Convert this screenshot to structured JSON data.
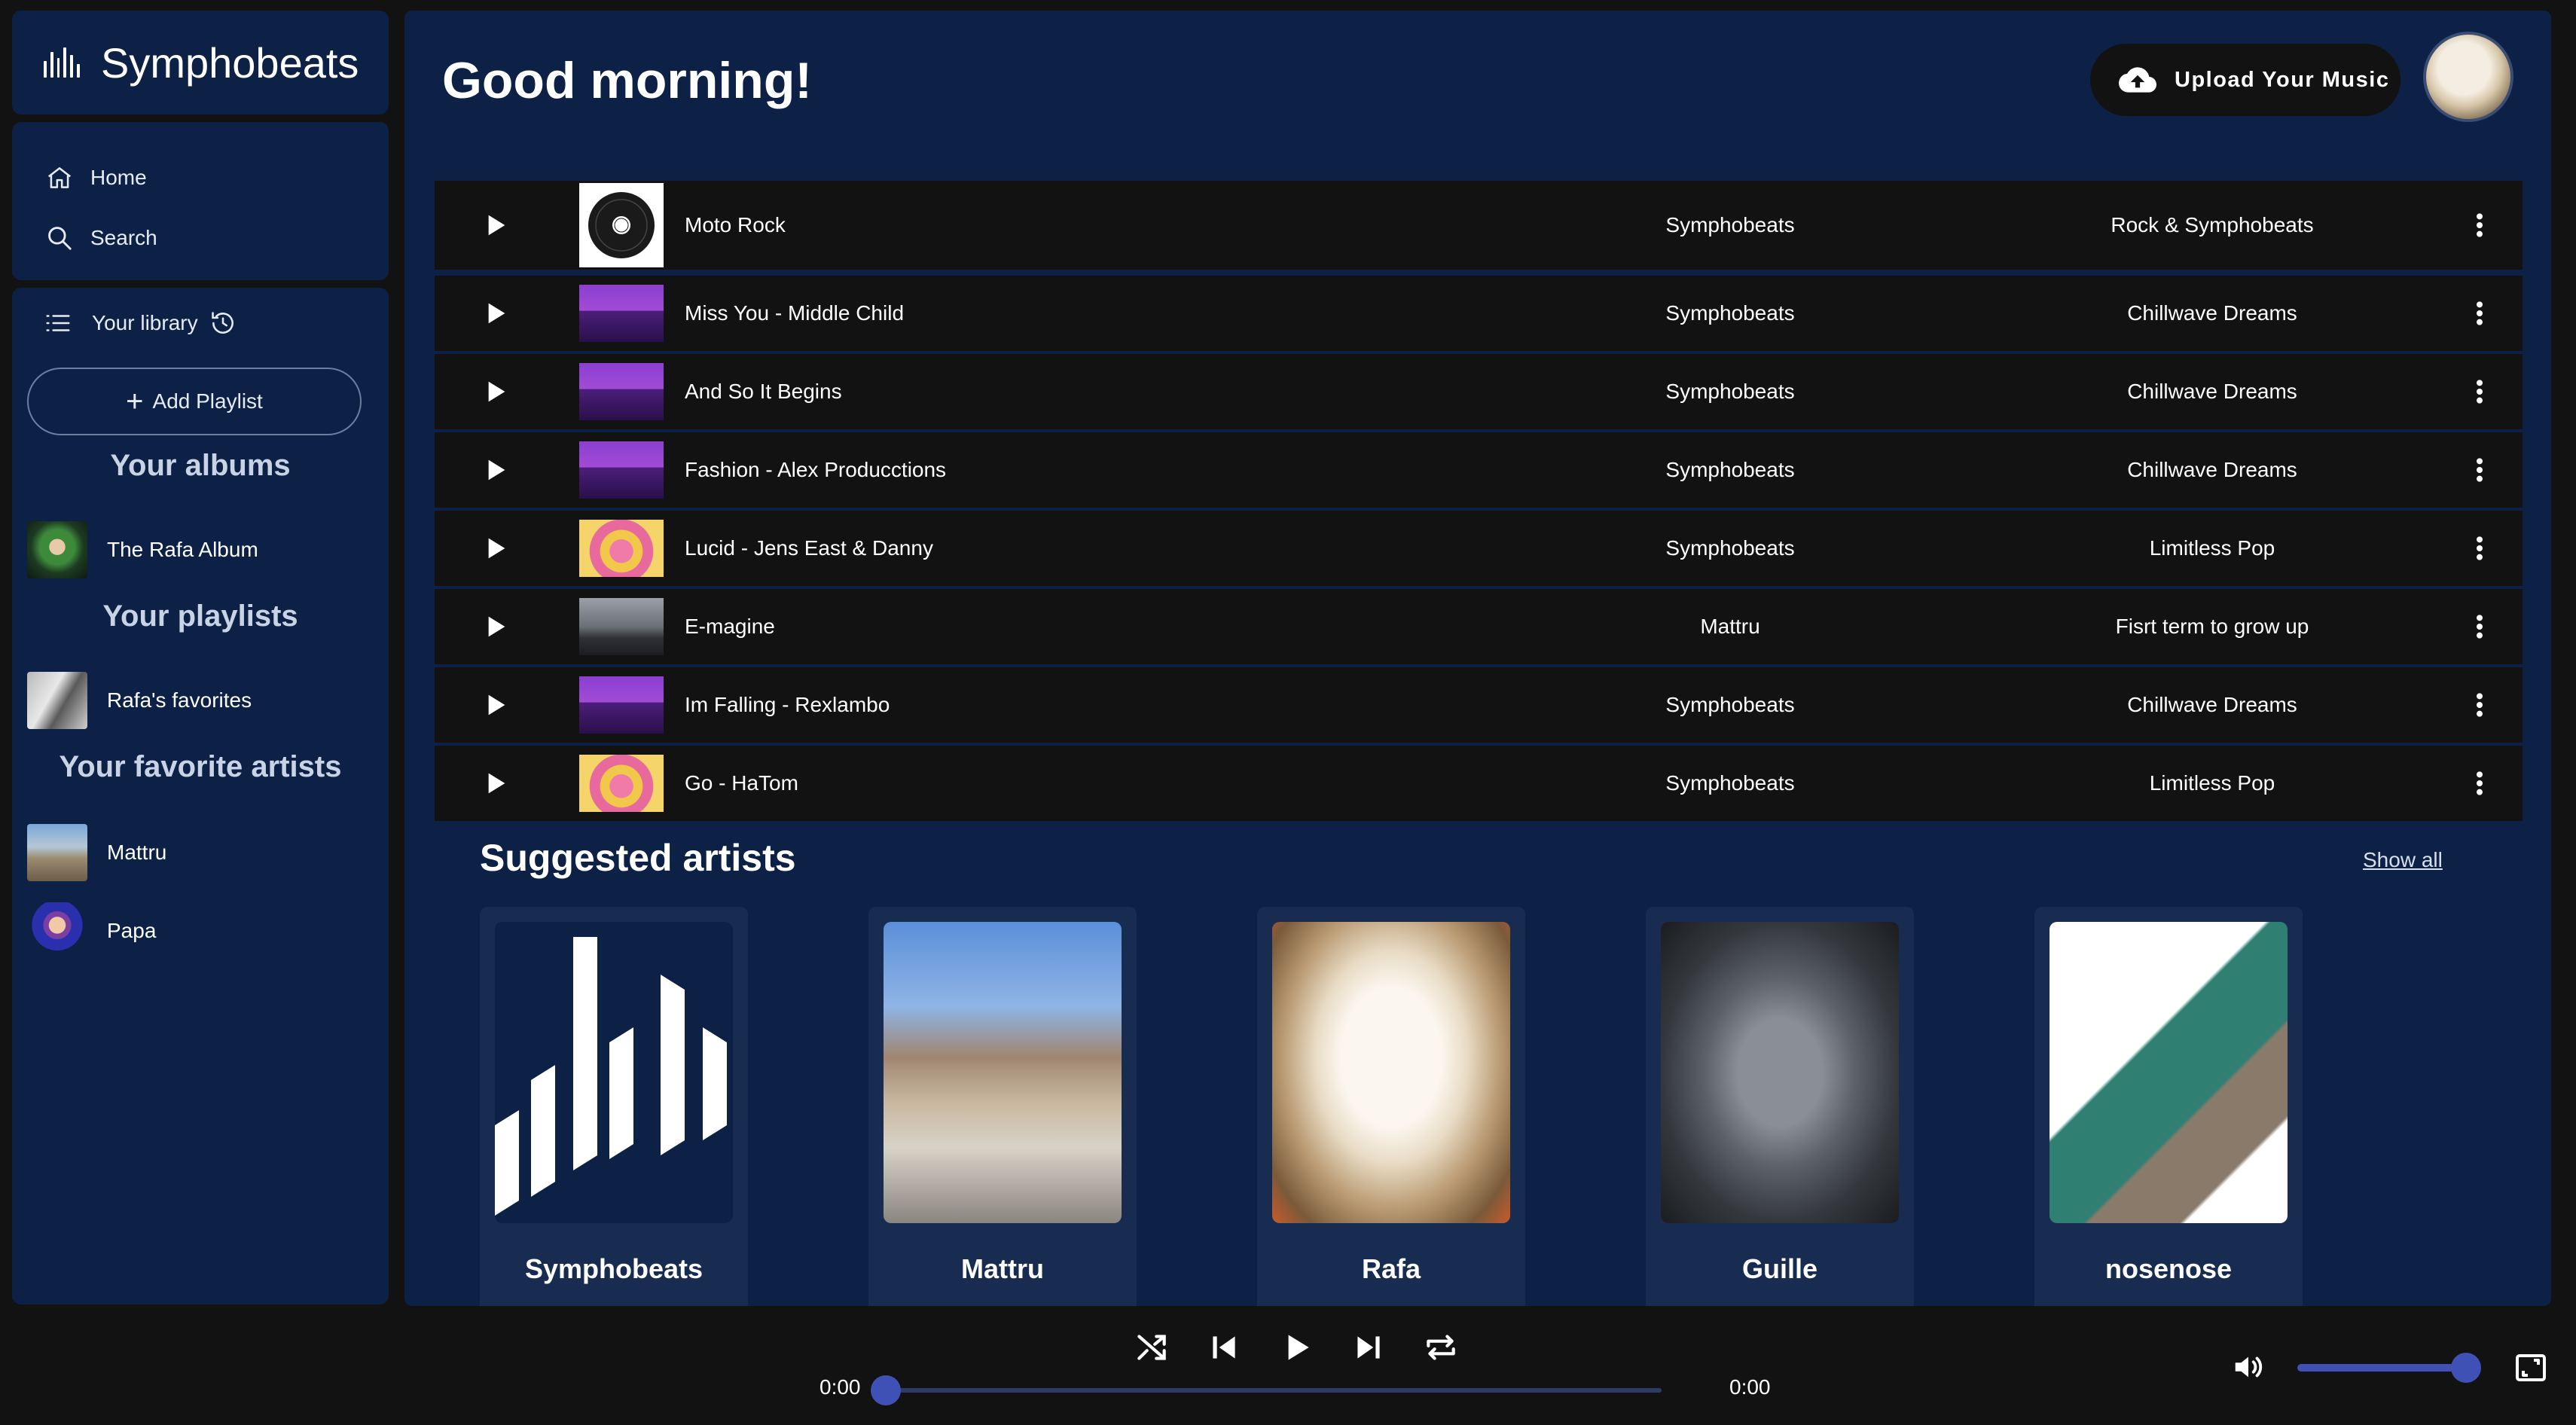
{
  "brand": {
    "name": "Symphobeats",
    "icon": "logo-bars-icon"
  },
  "nav": [
    {
      "label": "Home",
      "icon": "home-icon"
    },
    {
      "label": "Search",
      "icon": "search-icon"
    }
  ],
  "library": {
    "title": "Your library",
    "add_playlist": "Add Playlist",
    "albums_title": "Your albums",
    "albums": [
      {
        "name": "The Rafa Album"
      }
    ],
    "playlists_title": "Your playlists",
    "playlists": [
      {
        "name": "Rafa's favorites"
      }
    ],
    "artists_title": "Your favorite artists",
    "artists": [
      {
        "name": "Mattru"
      },
      {
        "name": "Papa"
      }
    ]
  },
  "header": {
    "greeting": "Good morning!",
    "upload_label": "Upload Your Music"
  },
  "tracks": [
    {
      "title": "Moto Rock",
      "artist": "Symphobeats",
      "album": "Rock & Symphobeats",
      "cover": "rock-roll"
    },
    {
      "title": "Miss You - Middle Child",
      "artist": "Symphobeats",
      "album": "Chillwave Dreams",
      "cover": "chillwave"
    },
    {
      "title": "And So It Begins",
      "artist": "Symphobeats",
      "album": "Chillwave Dreams",
      "cover": "chillwave"
    },
    {
      "title": "Fashion - Alex Producctions",
      "artist": "Symphobeats",
      "album": "Chillwave Dreams",
      "cover": "chillwave"
    },
    {
      "title": "Lucid - Jens East & Danny",
      "artist": "Symphobeats",
      "album": "Limitless Pop",
      "cover": "pop"
    },
    {
      "title": "E-magine",
      "artist": "Mattru",
      "album": "Fisrt term to grow up",
      "cover": "dusk"
    },
    {
      "title": "Im Falling - Rexlambo",
      "artist": "Symphobeats",
      "album": "Chillwave Dreams",
      "cover": "chillwave"
    },
    {
      "title": "Go - HaTom",
      "artist": "Symphobeats",
      "album": "Limitless Pop",
      "cover": "pop"
    }
  ],
  "suggested": {
    "title": "Suggested artists",
    "show_all": "Show all",
    "artists": [
      {
        "name": "Symphobeats"
      },
      {
        "name": "Mattru"
      },
      {
        "name": "Rafa"
      },
      {
        "name": "Guille"
      },
      {
        "name": "nosenose"
      }
    ]
  },
  "player": {
    "current_time": "0:00",
    "duration": "0:00",
    "progress": 0,
    "volume": 1.0
  },
  "colors": {
    "background": "#121212",
    "panel": "#0c2145",
    "card": "#182c52",
    "accent": "#3f51b5"
  }
}
